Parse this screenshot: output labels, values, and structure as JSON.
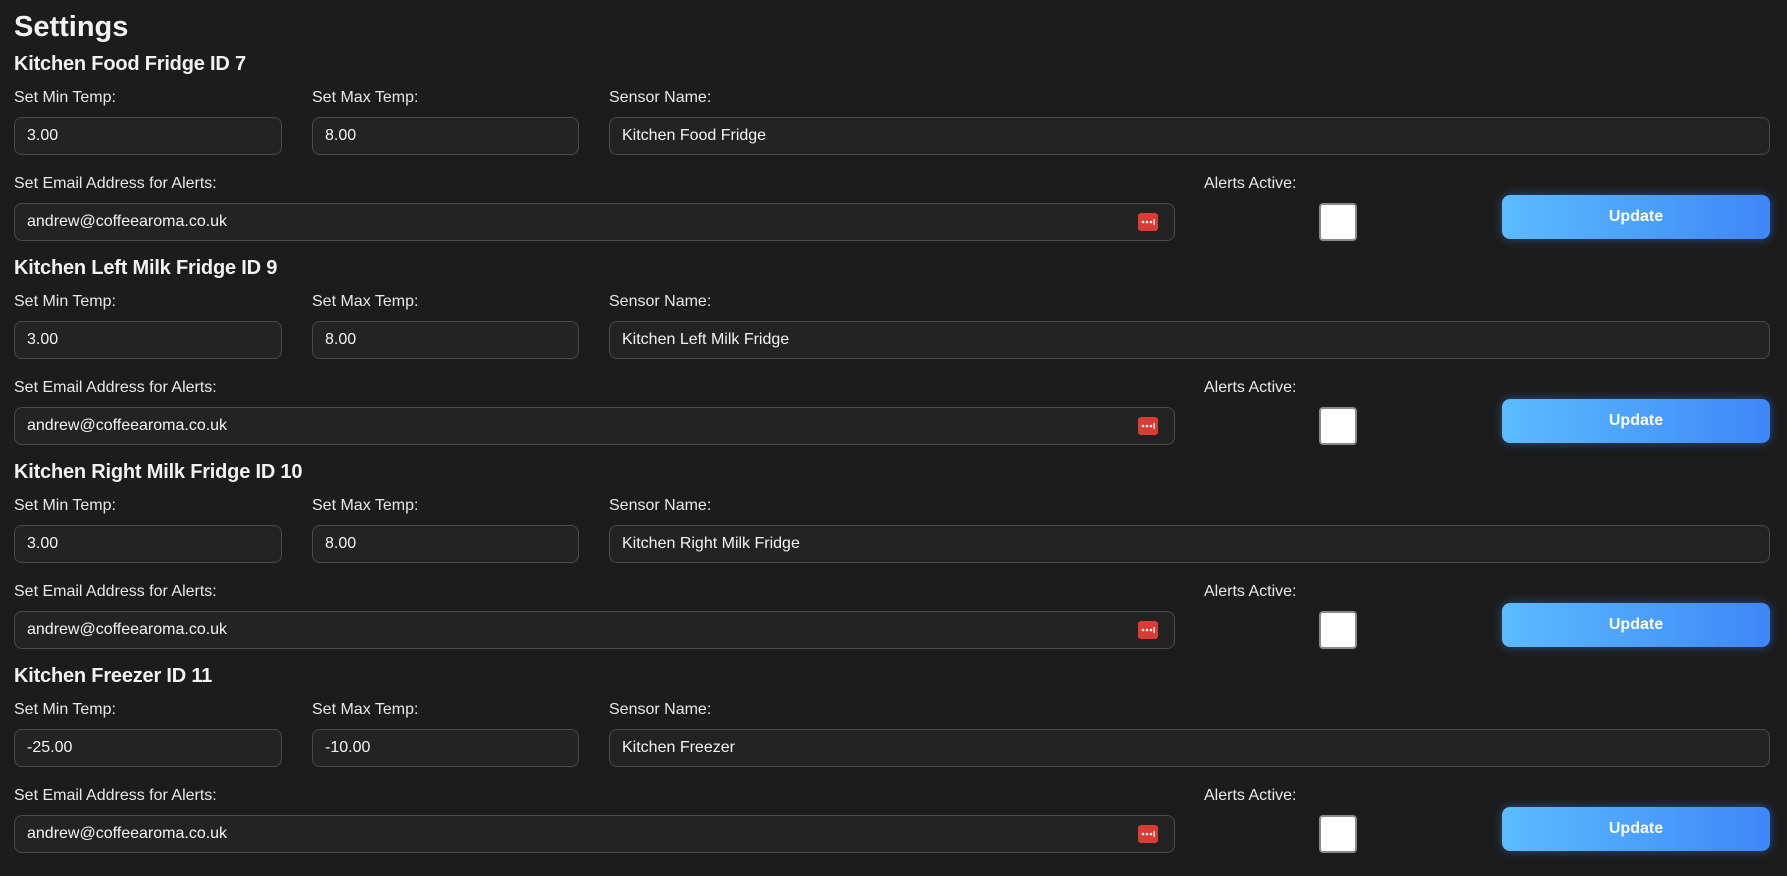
{
  "page": {
    "title": "Settings"
  },
  "labels": {
    "min_temp": "Set Min Temp:",
    "max_temp": "Set Max Temp:",
    "sensor_name": "Sensor Name:",
    "email": "Set Email Address for Alerts:",
    "alerts_active": "Alerts Active:",
    "update_button": "Update"
  },
  "icons": {
    "email_field_icon": "password-manager-icon"
  },
  "colors": {
    "background": "#1c1c1c",
    "field_background": "#232323",
    "button_gradient_start": "#5bbcff",
    "button_gradient_end": "#3f86f7",
    "password_icon": "#d93c35"
  },
  "sensors": [
    {
      "heading": "Kitchen Food Fridge ID 7",
      "min_temp": "3.00",
      "max_temp": "8.00",
      "sensor_name": "Kitchen Food Fridge",
      "email": "andrew@coffeearoma.co.uk",
      "alerts_active": false
    },
    {
      "heading": "Kitchen Left Milk Fridge ID 9",
      "min_temp": "3.00",
      "max_temp": "8.00",
      "sensor_name": "Kitchen Left Milk Fridge",
      "email": "andrew@coffeearoma.co.uk",
      "alerts_active": false
    },
    {
      "heading": "Kitchen Right Milk Fridge ID 10",
      "min_temp": "3.00",
      "max_temp": "8.00",
      "sensor_name": "Kitchen Right Milk Fridge",
      "email": "andrew@coffeearoma.co.uk",
      "alerts_active": false
    },
    {
      "heading": "Kitchen Freezer ID 11",
      "min_temp": "-25.00",
      "max_temp": "-10.00",
      "sensor_name": "Kitchen Freezer",
      "email": "andrew@coffeearoma.co.uk",
      "alerts_active": false
    }
  ]
}
